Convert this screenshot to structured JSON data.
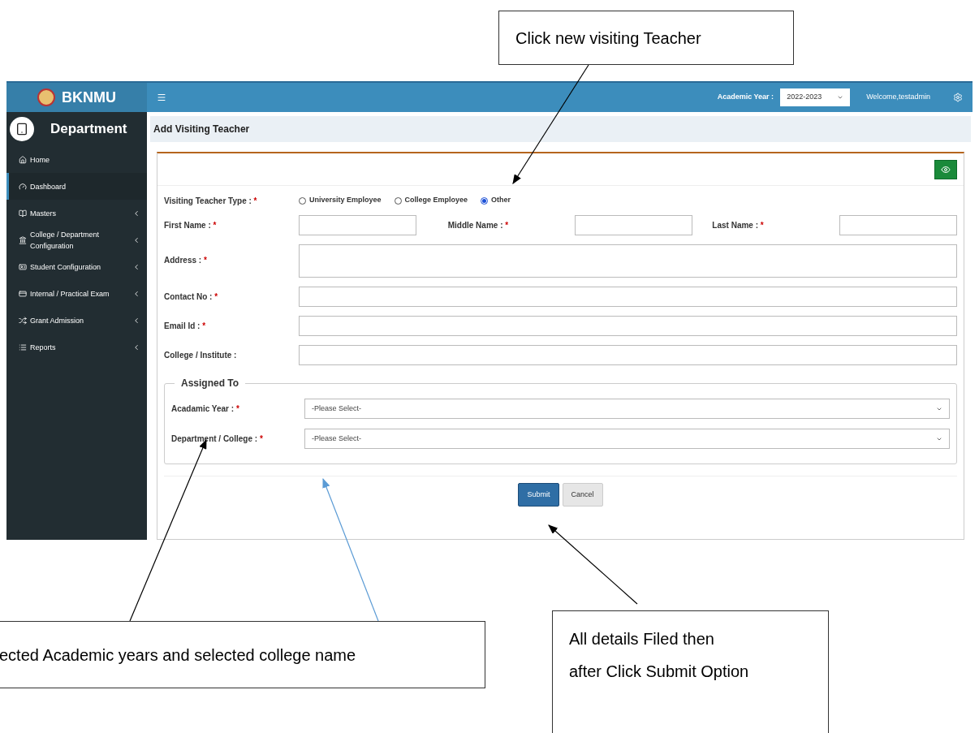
{
  "callouts": [
    {
      "text": "Click new visiting Teacher"
    },
    {
      "text": "ected Academic years and selected college name"
    },
    {
      "text": "All details Filed then\nafter Click Submit Option"
    }
  ],
  "sidebar": {
    "brand": "BKNMU",
    "section": "Department",
    "items": [
      {
        "label": "Home",
        "selected": false,
        "has_submenu": false
      },
      {
        "label": "Dashboard",
        "selected": true,
        "has_submenu": false
      },
      {
        "label": "Masters",
        "selected": false,
        "has_submenu": true
      },
      {
        "label": "College / Department Configuration",
        "selected": false,
        "has_submenu": true
      },
      {
        "label": "Student Configuration",
        "selected": false,
        "has_submenu": true
      },
      {
        "label": "Internal / Practical Exam",
        "selected": false,
        "has_submenu": true
      },
      {
        "label": "Grant Admission",
        "selected": false,
        "has_submenu": true
      },
      {
        "label": "Reports",
        "selected": false,
        "has_submenu": true
      }
    ]
  },
  "topbar": {
    "year_label": "Academic Year :",
    "year_value": "2022-2023",
    "welcome": "Welcome,testadmin"
  },
  "page_title": "Add Visiting Teacher",
  "form": {
    "type_field": {
      "label": "Visiting Teacher Type :",
      "marker": "*",
      "options": [
        {
          "label": "University Employee",
          "selected": false
        },
        {
          "label": "College Employee",
          "selected": false
        },
        {
          "label": "Other",
          "selected": true
        }
      ]
    },
    "name_row": [
      {
        "label": "First Name :",
        "marker": "*"
      },
      {
        "label": "Middle Name :",
        "marker": "*"
      },
      {
        "label": "Last Name :",
        "marker": "*"
      }
    ],
    "fields": [
      {
        "label": "Address :",
        "marker": "*",
        "kind": "textarea"
      },
      {
        "label": "Contact No :",
        "marker": "*",
        "kind": "input"
      },
      {
        "label": "Email Id :",
        "marker": "*",
        "kind": "input"
      },
      {
        "label": "College / Institute :",
        "kind": "input"
      }
    ],
    "assigned": {
      "legend": "Assigned To",
      "selects": [
        {
          "label": "Acadamic Year :",
          "marker": "*",
          "placeholder": "-Please Select-"
        },
        {
          "label": "Department / College :",
          "marker": "*",
          "placeholder": "-Please Select-"
        }
      ]
    },
    "buttons": [
      {
        "label": "Submit",
        "kind": "primary"
      },
      {
        "label": "Cancel",
        "kind": "secondary"
      }
    ]
  }
}
